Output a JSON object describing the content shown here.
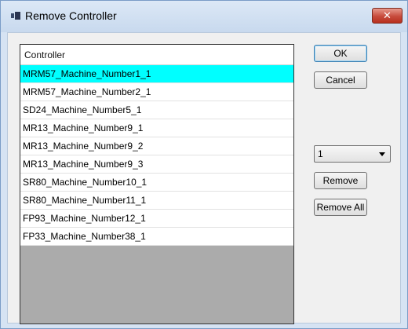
{
  "window": {
    "title": "Remove Controller",
    "close_symbol": "✕"
  },
  "list": {
    "header": "Controller",
    "items": [
      "MRM57_Machine_Number1_1",
      "MRM57_Machine_Number2_1",
      "SD24_Machine_Number5_1",
      "MR13_Machine_Number9_1",
      "MR13_Machine_Number9_2",
      "MR13_Machine_Number9_3",
      "SR80_Machine_Number10_1",
      "SR80_Machine_Number11_1",
      "FP93_Machine_Number12_1",
      "FP33_Machine_Number38_1"
    ],
    "selected_index": 0,
    "selected_color": "#00ffff"
  },
  "buttons": {
    "ok": "OK",
    "cancel": "Cancel",
    "remove": "Remove",
    "remove_all": "Remove All"
  },
  "combo": {
    "value": "1"
  },
  "icons": {
    "app": "app-icon",
    "close": "close-icon",
    "dropdown": "chevron-down-icon"
  }
}
